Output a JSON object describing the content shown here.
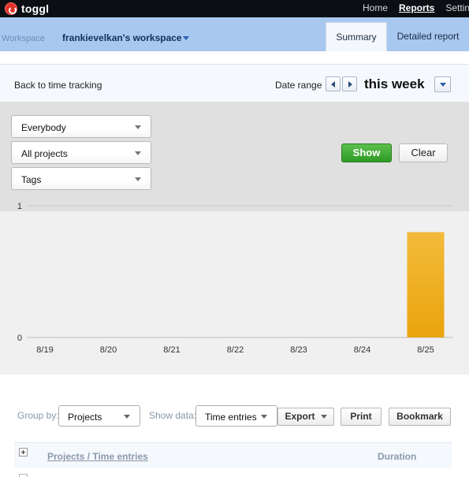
{
  "app": {
    "logo_text": "toggl"
  },
  "topnav": [
    "Home",
    "Reports",
    "Settin"
  ],
  "workspace": {
    "label": "Workspace",
    "name": "frankievelkan's workspace"
  },
  "tabs": [
    "Summary",
    "Detailed report"
  ],
  "toolbar": {
    "back_label": "Back to time tracking",
    "date_range_label": "Date range",
    "period": "this week"
  },
  "filters": {
    "user": "Everybody",
    "projects": "All projects",
    "tags": "Tags",
    "show_label": "Show",
    "clear_label": "Clear"
  },
  "colors": {
    "bar": "#f0b323",
    "show_button": "#3aa52f",
    "workspace_bar": "#a8c8ef"
  },
  "chart_data": {
    "type": "bar",
    "categories": [
      "8/19",
      "8/20",
      "8/21",
      "8/22",
      "8/23",
      "8/24",
      "8/25"
    ],
    "values": [
      0,
      0,
      0,
      0,
      0,
      0,
      0.8
    ],
    "ylim": [
      0,
      1
    ],
    "y_ticks": [
      "0",
      "1"
    ],
    "grid": false
  },
  "controls": {
    "group_by_label": "Group by:",
    "group_by_value": "Projects",
    "show_data_label": "Show data:",
    "show_data_value": "Time entries",
    "export_label": "Export",
    "print_label": "Print",
    "bookmark_label": "Bookmark"
  },
  "table": {
    "col_projects": "Projects / Time entries",
    "col_duration": "Duration"
  }
}
